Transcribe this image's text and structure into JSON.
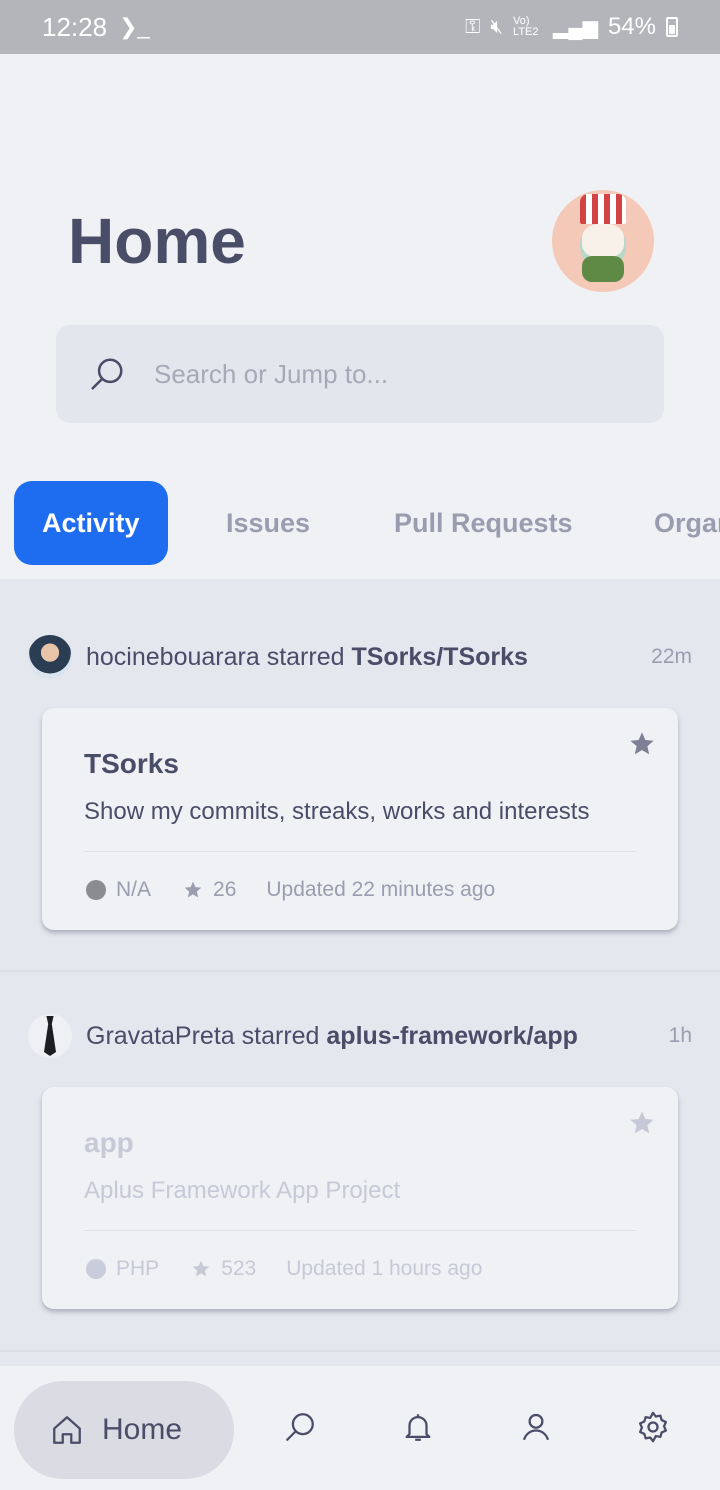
{
  "status_bar": {
    "time": "12:28",
    "terminal_glyph": "❯_",
    "signal_text": "Vo) LTE2",
    "battery": "54%"
  },
  "header": {
    "title": "Home",
    "search_placeholder": "Search or Jump to..."
  },
  "tabs": [
    {
      "label": "Activity",
      "active": true
    },
    {
      "label": "Issues",
      "active": false
    },
    {
      "label": "Pull Requests",
      "active": false
    },
    {
      "label": "Organizations",
      "active": false
    }
  ],
  "feed": [
    {
      "actor": "hocinebouarara",
      "action": "starred",
      "repo_full": "TSorks/TSorks",
      "time": "22m",
      "card": {
        "name": "TSorks",
        "description": "Show my commits, streaks, works and interests",
        "language": "N/A",
        "stars": "26",
        "updated": "Updated 22 minutes ago"
      }
    },
    {
      "actor": "GravataPreta",
      "action": "starred",
      "repo_full": "aplus-framework/app",
      "time": "1h",
      "card": {
        "name": "app",
        "description": "Aplus Framework App Project",
        "language": "PHP",
        "stars": "523",
        "updated": "Updated 1 hours ago"
      }
    }
  ],
  "bottom_nav": {
    "home_label": "Home",
    "icons": [
      "home-icon",
      "search-icon",
      "bell-icon",
      "user-icon",
      "gear-icon"
    ]
  },
  "colors": {
    "accent": "#1e6df0",
    "text": "#4a4d68",
    "muted": "#9a9db0",
    "background": "#f0f1f5",
    "feed_background": "#e5e7ef"
  }
}
